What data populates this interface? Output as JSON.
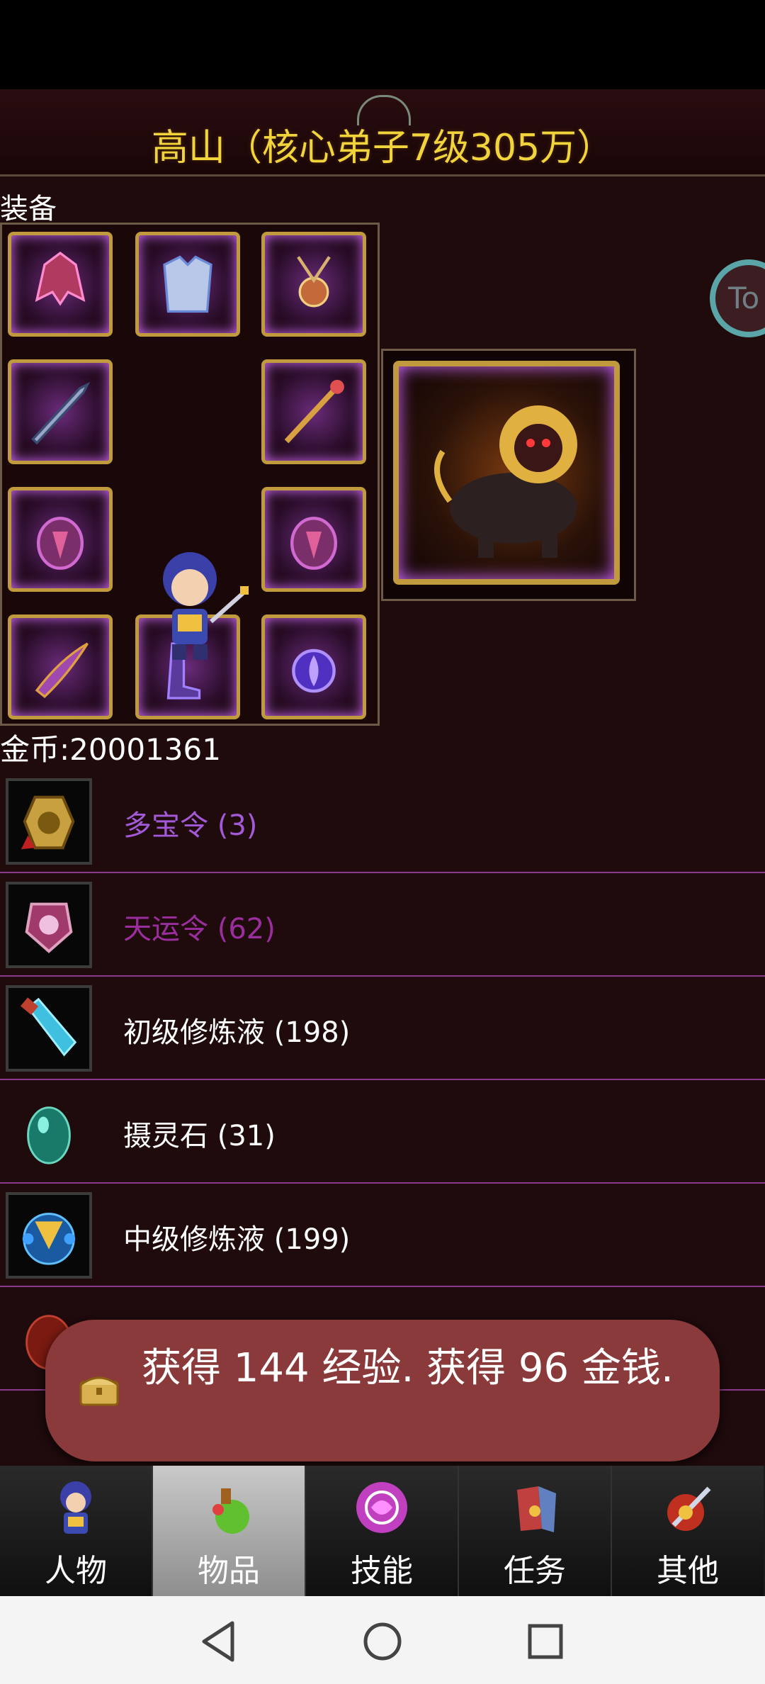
{
  "header": {
    "title": "高山（核心弟子7级305万）"
  },
  "equipment": {
    "label": "装备",
    "side_button_label": "To",
    "slots": [
      {
        "icon": "helmet-icon"
      },
      {
        "icon": "armor-icon"
      },
      {
        "icon": "necklace-icon"
      },
      {
        "icon": "sword-icon"
      },
      {
        "icon": "staff-icon"
      },
      {
        "icon": "bracer-icon"
      },
      {
        "icon": "bracer-icon"
      },
      {
        "icon": "blade-icon"
      },
      {
        "icon": "boots-icon"
      },
      {
        "icon": "orb-icon"
      }
    ],
    "pet": {
      "icon": "lion-pet-icon"
    }
  },
  "gold": {
    "label": "金币:20001361"
  },
  "items": [
    {
      "label": "多宝令 (3)",
      "color": "#a35ad8",
      "icon": "token-icon"
    },
    {
      "label": "天运令 (62)",
      "color": "#9b2e9e",
      "icon": "fortune-token-icon"
    },
    {
      "label": "初级修炼液 (198)",
      "color": "#ffffff",
      "icon": "potion-icon"
    },
    {
      "label": "摄灵石 (31)",
      "color": "#ffffff",
      "icon": "spirit-stone-icon"
    },
    {
      "label": "中级修炼液 (199)",
      "color": "#ffffff",
      "icon": "elixir-icon"
    }
  ],
  "toast": {
    "text": "获得 144 经验. 获得 96 金钱."
  },
  "tabs": [
    {
      "label": "人物",
      "icon": "character-icon"
    },
    {
      "label": "物品",
      "icon": "items-icon"
    },
    {
      "label": "技能",
      "icon": "skills-icon"
    },
    {
      "label": "任务",
      "icon": "quests-icon"
    },
    {
      "label": "其他",
      "icon": "other-icon"
    }
  ],
  "active_tab": "物品"
}
